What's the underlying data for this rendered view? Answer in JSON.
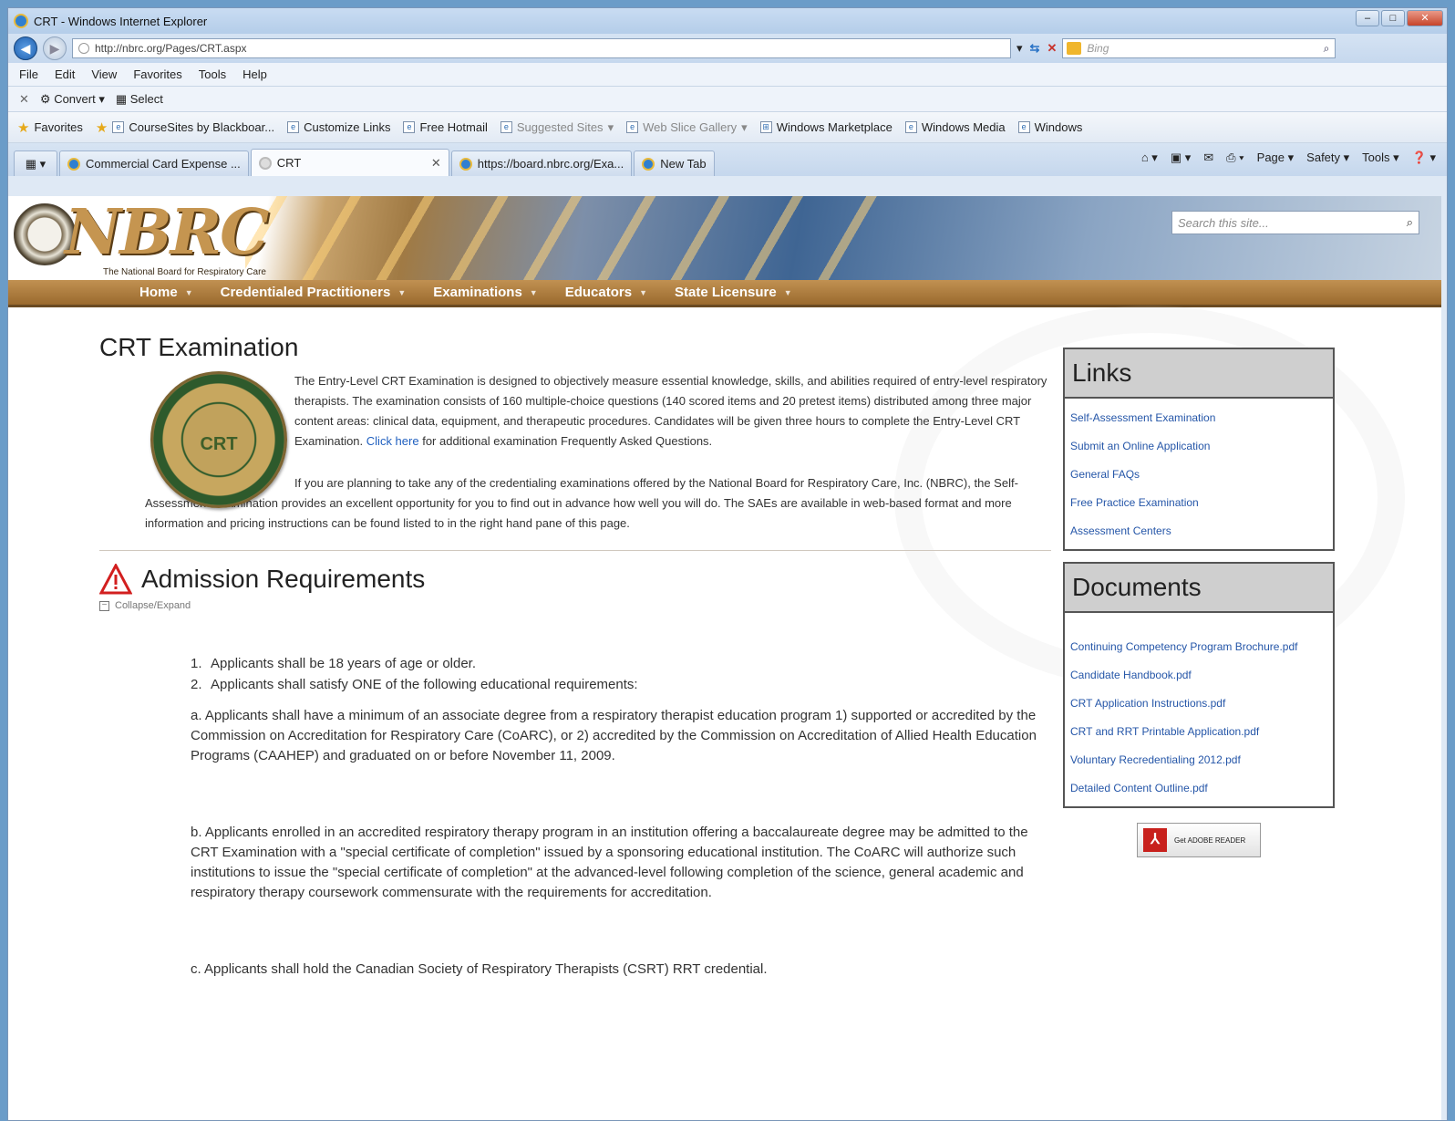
{
  "window": {
    "title": "CRT - Windows Internet Explorer"
  },
  "address": {
    "url": "http://nbrc.org/Pages/CRT.aspx",
    "search_placeholder": "Bing"
  },
  "menu": [
    "File",
    "Edit",
    "View",
    "Favorites",
    "Tools",
    "Help"
  ],
  "commandbar": {
    "convert": "Convert",
    "select": "Select"
  },
  "favorites": {
    "label": "Favorites",
    "items": [
      "CourseSites by Blackboar...",
      "Customize Links",
      "Free Hotmail",
      "Suggested Sites",
      "Web Slice Gallery",
      "Windows Marketplace",
      "Windows Media",
      "Windows"
    ]
  },
  "tabs": [
    "Commercial Card Expense ...",
    "CRT",
    "https://board.nbrc.org/Exa...",
    "New Tab"
  ],
  "tabtools": [
    "Page",
    "Safety",
    "Tools"
  ],
  "site": {
    "logo": "NBRC",
    "logo_sub": "The National Board for Respiratory Care",
    "search_placeholder": "Search this site...",
    "nav": [
      "Home",
      "Credentialed Practitioners",
      "Examinations",
      "Educators",
      "State Licensure"
    ]
  },
  "main": {
    "title": "CRT Examination",
    "seal_text": "CRT",
    "intro_p1_before": "The Entry-Level CRT Examination is designed to objectively measure essential knowledge, skills, and abilities required of entry-level respiratory therapists. The examination consists of 160 multiple-choice questions (140 scored items and 20 pretest items) distributed among three major content areas: clinical data, equipment, and therapeutic procedures. Candidates will be given three hours to complete the Entry-Level CRT Examination.",
    "intro_link": "Click here",
    "intro_p1_after": "for additional examination Frequently Asked Questions.",
    "intro_p2": "If you are planning to take any of the credentialing examinations offered by the National Board for Respiratory Care, Inc. (NBRC), the Self-Assessment Examination provides an excellent opportunity for you to find out in advance how well you will do. The SAEs are available in web-based format and more information and pricing instructions can be found listed to in the right hand pane of this page.",
    "admission_title": "Admission Requirements",
    "collapse_label": "Collapse/Expand",
    "requirements": [
      "Applicants shall be 18 years of age or older.",
      "Applicants shall satisfy ONE of the following educational requirements:"
    ],
    "req_a": "a. Applicants shall have a minimum of an associate degree from a respiratory therapist education program 1) supported or accredited by the Commission on Accreditation for Respiratory Care (CoARC), or 2) accredited by the Commission on Accreditation of Allied Health Education Programs (CAAHEP) and graduated on or before November 11, 2009.",
    "req_b": "b. Applicants enrolled in an accredited respiratory therapy program in an institution offering a baccalaureate degree may be admitted to the CRT Examination with a \"special certificate of completion\" issued by a sponsoring educational institution. The CoARC will authorize such institutions to issue the \"special certificate of completion\" at the advanced-level following completion of the science, general academic and respiratory therapy coursework commensurate with the requirements for accreditation.",
    "req_c": "c. Applicants shall hold the Canadian Society of Respiratory Therapists (CSRT) RRT credential."
  },
  "sidebar": {
    "links_title": "Links",
    "links": [
      "Self-Assessment Examination",
      "Submit an Online Application",
      "General FAQs",
      "Free Practice Examination",
      "Assessment Centers"
    ],
    "docs_title": "Documents",
    "docs": [
      "Continuing Competency Program Brochure.pdf",
      "Candidate Handbook.pdf",
      "CRT Application Instructions.pdf",
      "CRT and RRT Printable Application.pdf",
      "Voluntary Recredentialing 2012.pdf",
      "Detailed Content Outline.pdf"
    ],
    "adobe_label": "Get ADOBE READER"
  },
  "colors": {
    "nav_gold": "#b0823f",
    "link_blue": "#2556a8"
  }
}
